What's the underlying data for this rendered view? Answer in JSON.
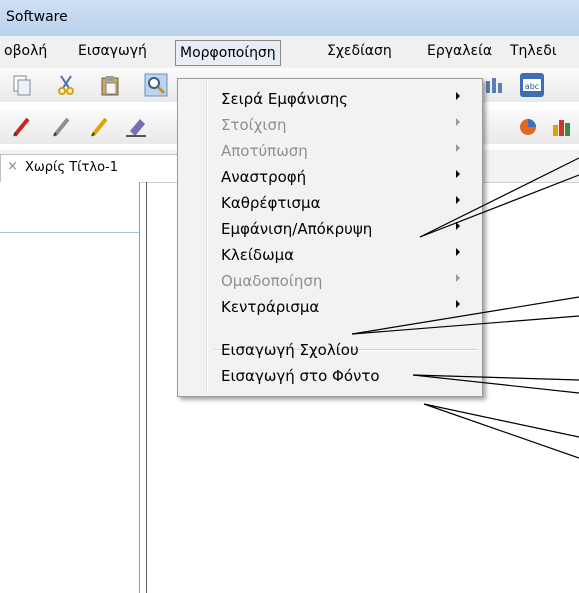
{
  "title": "Software",
  "menubar": {
    "items": [
      {
        "label": "οβολή",
        "active": false
      },
      {
        "label": "Εισαγωγή",
        "active": false
      },
      {
        "label": "Μορφοποίηση",
        "active": true
      },
      {
        "label": "Σχεδίαση",
        "active": false
      },
      {
        "label": "Εργαλεία",
        "active": false
      },
      {
        "label": "Τηλεδι",
        "active": false
      }
    ]
  },
  "toolbar1": {
    "icons": [
      "copy-icon",
      "cut-icon",
      "paste-icon",
      "search-icon",
      "chart-icon",
      "abc-icon"
    ],
    "abc_label": "abc"
  },
  "toolbar2": {
    "icons": [
      "red-pen-icon",
      "gray-pen-icon",
      "pencil-icon",
      "eraser-icon",
      "pie-chart-icon",
      "bar-chart-icon"
    ]
  },
  "tab": {
    "close": "×",
    "label": "Χωρίς Τίτλο-1"
  },
  "dropdown": {
    "items": [
      {
        "label": "Σειρά Εμφάνισης",
        "submenu": true,
        "disabled": false
      },
      {
        "label": "Στοίχιση",
        "submenu": true,
        "disabled": true
      },
      {
        "label": "Αποτύπωση",
        "submenu": true,
        "disabled": true
      },
      {
        "label": "Αναστροφή",
        "submenu": true,
        "disabled": false
      },
      {
        "label": "Καθρέφτισμα",
        "submenu": true,
        "disabled": false
      },
      {
        "label": "Εμφάνιση/Απόκρυψη",
        "submenu": true,
        "disabled": false
      },
      {
        "label": "Κλείδωμα",
        "submenu": true,
        "disabled": false
      },
      {
        "label": "Ομαδοποίηση",
        "submenu": true,
        "disabled": true
      },
      {
        "label": "Κεντράρισμα",
        "submenu": true,
        "disabled": false
      },
      {
        "label": "Εισαγωγή Σχολίου",
        "submenu": false,
        "disabled": false
      },
      {
        "label": "Εισαγωγή στο Φόντο",
        "submenu": false,
        "disabled": false
      }
    ]
  },
  "colors": {
    "titlebar": "#c4d9f0",
    "menu_bg": "#f2f2f2",
    "disabled_text": "#8f8f8f",
    "callout_line": "#000000"
  }
}
